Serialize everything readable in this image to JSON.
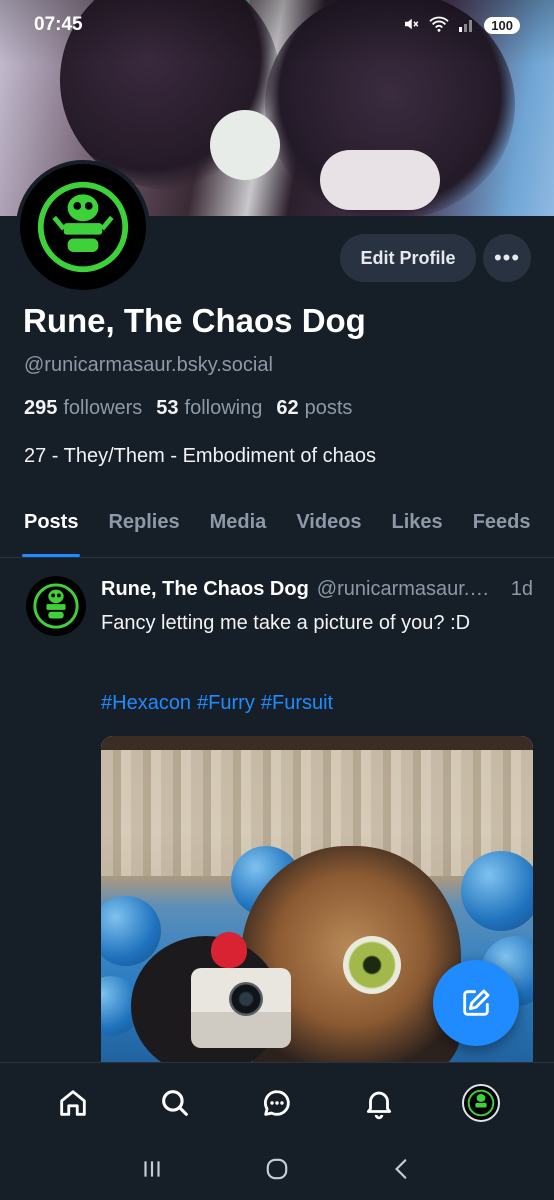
{
  "status_bar": {
    "time": "07:45",
    "battery": "100"
  },
  "profile": {
    "display_name": "Rune, The Chaos Dog",
    "handle": "@runicarmasaur.bsky.social",
    "followers_count": "295",
    "followers_label": "followers",
    "following_count": "53",
    "following_label": "following",
    "posts_count": "62",
    "posts_label": "posts",
    "bio": "27 - They/Them - Embodiment of chaos",
    "edit_button": "Edit Profile",
    "more_button": "•••"
  },
  "tabs": [
    {
      "label": "Posts",
      "active": true
    },
    {
      "label": "Replies"
    },
    {
      "label": "Media"
    },
    {
      "label": "Videos"
    },
    {
      "label": "Likes"
    },
    {
      "label": "Feeds"
    }
  ],
  "post": {
    "author_name": "Rune, The Chaos Dog",
    "author_handle": "@runicarmasaur.bsky.social",
    "time": "1d",
    "text": "Fancy letting me take a picture of you? :D",
    "hashtags": [
      "#Hexacon",
      "#Furry",
      "#Fursuit"
    ]
  },
  "bottom_nav": [
    "home-icon",
    "search-icon",
    "chat-icon",
    "bell-icon",
    "profile-avatar"
  ],
  "system_nav": [
    "recents-icon",
    "home-circle-icon",
    "back-icon"
  ],
  "colors": {
    "background": "#161e27",
    "accent": "#208bfe",
    "muted": "#8d99a8",
    "avatar_green": "#3fd13a"
  }
}
